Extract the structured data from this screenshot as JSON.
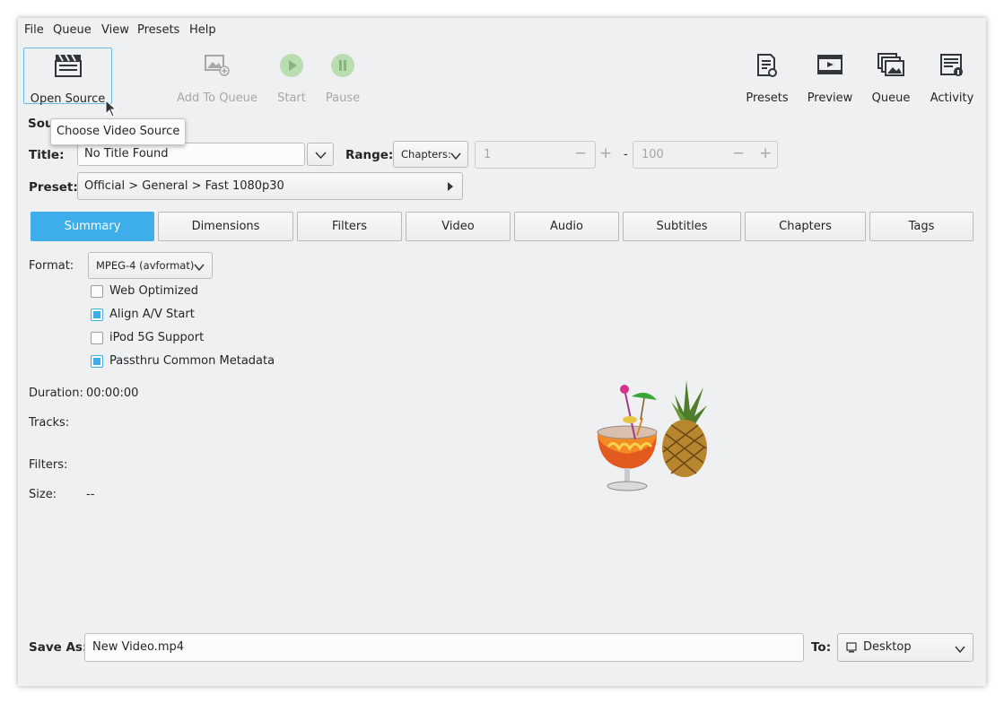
{
  "menu": [
    "File",
    "Queue",
    "View",
    "Presets",
    "Help"
  ],
  "toolbar": {
    "open_source": "Open Source",
    "add_to_queue": "Add To Queue",
    "start": "Start",
    "pause": "Pause",
    "presets": "Presets",
    "preview": "Preview",
    "queue": "Queue",
    "activity": "Activity"
  },
  "tooltip": "Choose Video Source",
  "source": {
    "label_partial": "Sou",
    "title_label": "Title:",
    "title_value": "No Title Found",
    "range_label": "Range:",
    "range_mode": "Chapters:",
    "range_start": "1",
    "range_sep": "-",
    "range_end": "100",
    "preset_label": "Preset:",
    "preset_value": "Official > General > Fast 1080p30"
  },
  "tabs": [
    "Summary",
    "Dimensions",
    "Filters",
    "Video",
    "Audio",
    "Subtitles",
    "Chapters",
    "Tags"
  ],
  "active_tab": "Summary",
  "summary": {
    "format_label": "Format:",
    "format_value": "MPEG-4 (avformat)",
    "options": [
      {
        "label": "Web Optimized",
        "checked": false
      },
      {
        "label": "Align A/V Start",
        "checked": true
      },
      {
        "label": "iPod 5G Support",
        "checked": false
      },
      {
        "label": "Passthru Common Metadata",
        "checked": true
      }
    ],
    "duration_label": "Duration:",
    "duration_value": "00:00:00",
    "tracks_label": "Tracks:",
    "filters_label": "Filters:",
    "size_label": "Size:",
    "size_value": "--"
  },
  "output": {
    "save_as_label": "Save As:",
    "save_as_value": "New Video.mp4",
    "to_label": "To:",
    "to_value": "Desktop"
  },
  "colors": {
    "accent": "#3daee9",
    "window_bg": "#eff0f1"
  }
}
